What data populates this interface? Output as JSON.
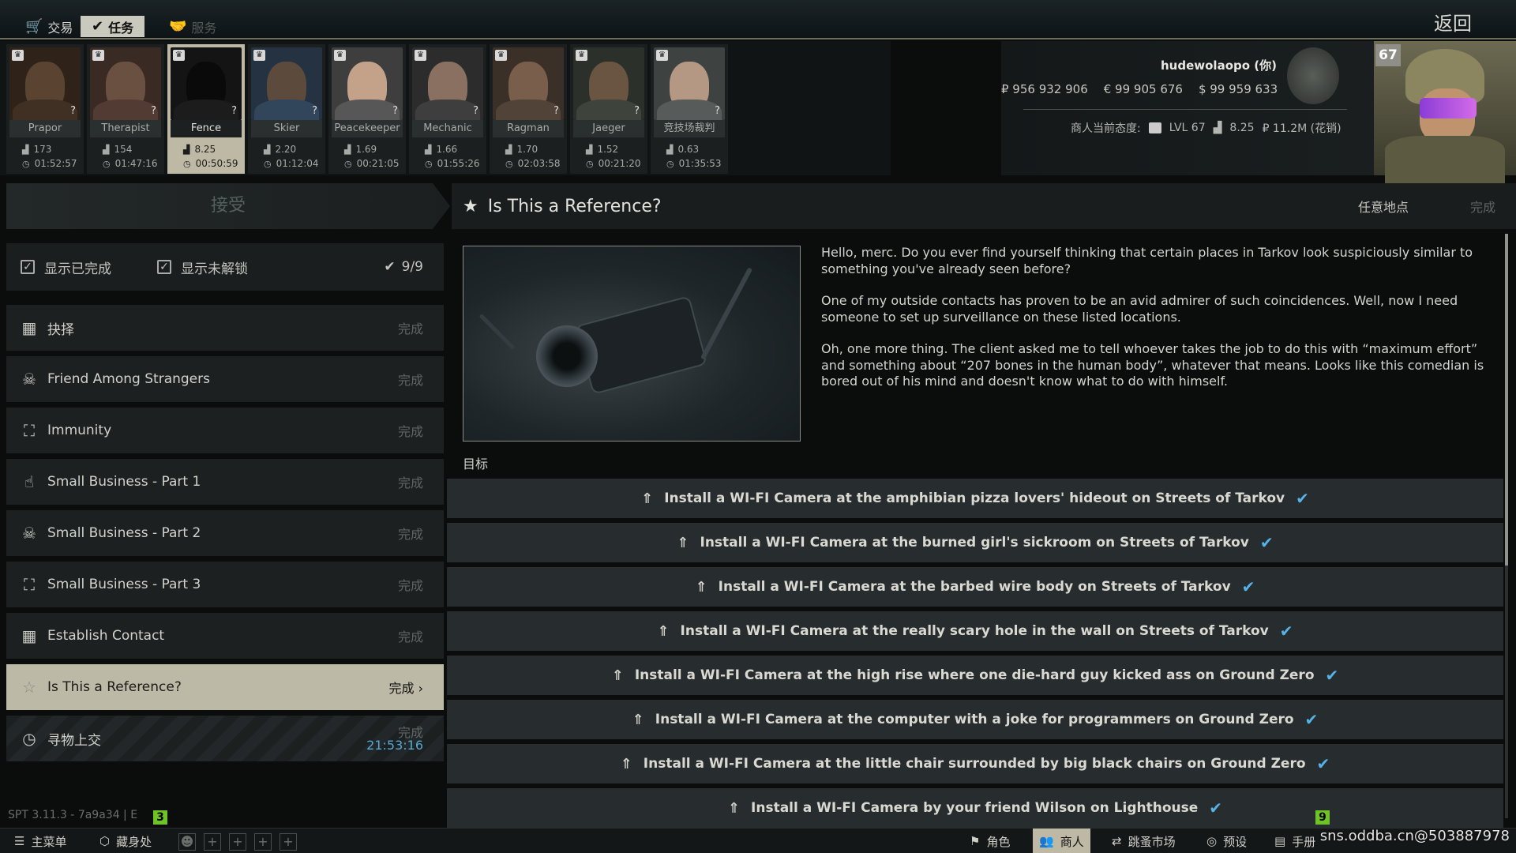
{
  "topbar": {
    "tabs": [
      {
        "label": "交易",
        "icon": "cart-icon",
        "state": "normal"
      },
      {
        "label": "任务",
        "icon": "check-circle-icon",
        "state": "active"
      },
      {
        "label": "服务",
        "icon": "handshake-icon",
        "state": "disabled"
      }
    ],
    "back_label": "返回"
  },
  "traders": [
    {
      "name": "Prapor",
      "standing": "173",
      "timer": "01:52:57"
    },
    {
      "name": "Therapist",
      "standing": "154",
      "timer": "01:47:16"
    },
    {
      "name": "Fence",
      "standing": "8.25",
      "timer": "00:50:59"
    },
    {
      "name": "Skier",
      "standing": "2.20",
      "timer": "01:12:04"
    },
    {
      "name": "Peacekeeper",
      "standing": "1.69",
      "timer": "00:21:05"
    },
    {
      "name": "Mechanic",
      "standing": "1.66",
      "timer": "01:55:26"
    },
    {
      "name": "Ragman",
      "standing": "1.70",
      "timer": "02:03:58"
    },
    {
      "name": "Jaeger",
      "standing": "1.52",
      "timer": "00:21:20"
    },
    {
      "name": "竞技场裁判",
      "standing": "0.63",
      "timer": "01:35:53"
    }
  ],
  "profile": {
    "name": "hudewolaopo (你)",
    "roubles": "₽ 956 932 906",
    "euros": "€ 99 905 676",
    "dollars": "$ 99 959 633",
    "attitude_label": "商人当前态度:",
    "level": "LVL 67",
    "standing": "8.25",
    "spent": "₽ 11.2M (花销)",
    "level_badge": "67"
  },
  "left_panel": {
    "header": "接受",
    "filter_completed": "显示已完成",
    "filter_locked": "显示未解锁",
    "count": "9/9",
    "quests": [
      {
        "title": "抉择",
        "status": "完成",
        "icon": "map-icon"
      },
      {
        "title": "Friend Among Strangers",
        "status": "完成",
        "icon": "skull-icon"
      },
      {
        "title": "Immunity",
        "status": "完成",
        "icon": "runner-icon"
      },
      {
        "title": "Small Business - Part 1",
        "status": "完成",
        "icon": "hand-icon"
      },
      {
        "title": "Small Business - Part 2",
        "status": "完成",
        "icon": "skull-icon"
      },
      {
        "title": "Small Business - Part 3",
        "status": "完成",
        "icon": "runner-icon"
      },
      {
        "title": "Establish Contact",
        "status": "完成",
        "icon": "map-icon"
      },
      {
        "title": "Is This a Reference?",
        "status": "完成",
        "icon": "star-icon"
      },
      {
        "title": "寻物上交",
        "status": "完成",
        "icon": "clock-icon",
        "timer": "21:53:16"
      }
    ],
    "version": "SPT 3.11.3 - 7a9a34 | ",
    "version_suffix": "E",
    "badge_left": "3"
  },
  "quest": {
    "title": "Is This a Reference?",
    "location": "任意地点",
    "status": "完成",
    "description": [
      "Hello, merc. Do you ever find yourself thinking that certain places in Tarkov look suspiciously similar to something you've already seen before?",
      "One of my outside contacts has proven to be an avid admirer of such coincidences. Well, now I need someone to set up surveillance on these listed locations.",
      "Oh, one more thing. The client asked me to tell whoever takes the job to do this with “maximum effort” and something about “207 bones in the human body”, whatever that means. Looks like this comedian is bored out of his mind and doesn't know what to do with himself."
    ],
    "objectives_label": "目标",
    "objectives": [
      "Install a WI-FI Camera at the amphibian pizza lovers' hideout on Streets of Tarkov",
      "Install a WI-FI Camera at the burned girl's sickroom on Streets of Tarkov",
      "Install a WI-FI Camera at the barbed wire body on Streets of Tarkov",
      "Install a WI-FI Camera at the really scary hole in the wall on Streets of Tarkov",
      "Install a WI-FI Camera at the high rise where one die-hard guy kicked ass on Ground Zero",
      "Install a WI-FI Camera at the computer with a joke for programmers on Ground Zero",
      "Install a WI-FI Camera at the little chair surrounded by big black chairs on Ground Zero",
      "Install a WI-FI Camera by your friend Wilson on Lighthouse"
    ]
  },
  "bottombar": {
    "main_menu": "主菜单",
    "hideout": "藏身处",
    "character": "角色",
    "traders": "商人",
    "flea_market": "跳蚤市场",
    "presets": "预设",
    "handbook": "手册",
    "badge_right": "9",
    "watermark": "sns.oddba.cn@503887978"
  },
  "colors": {
    "accent": "#bdb9a5",
    "check": "#56b3e8",
    "timer": "#58a9d2",
    "badge": "#6ec326"
  }
}
